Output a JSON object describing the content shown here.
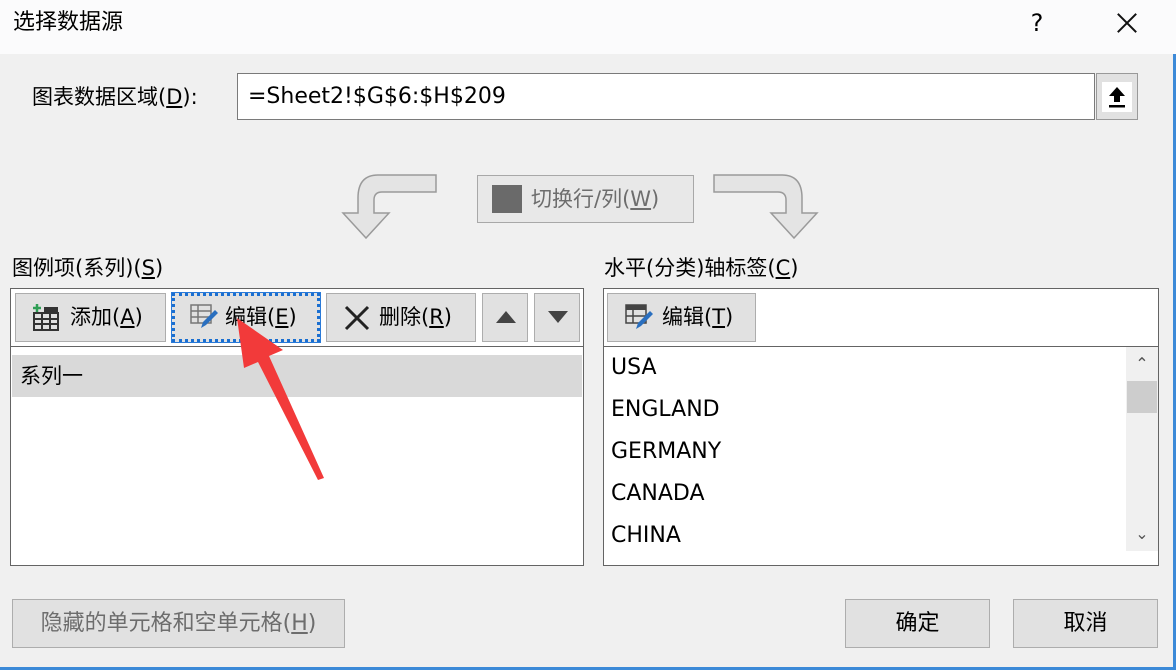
{
  "window": {
    "title": "选择数据源",
    "help_label": "?",
    "close_icon": "close-icon"
  },
  "range": {
    "label_prefix": "图表数据区域(",
    "label_key": "D",
    "label_suffix": "):",
    "value": "=Sheet2!$G$6:$H$209",
    "collapse_icon": "upload-arrow-icon"
  },
  "switch": {
    "label_prefix": "切换行/列(",
    "label_key": "W",
    "label_suffix": ")",
    "enabled": false
  },
  "series_panel": {
    "label_prefix": "图例项(系列)(",
    "label_key": "S",
    "label_suffix": ")",
    "toolbar": {
      "add": {
        "text": "添加(",
        "key": "A",
        "end": ")"
      },
      "edit": {
        "text": "编辑(",
        "key": "E",
        "end": ")"
      },
      "delete": {
        "text": "删除(",
        "key": "R",
        "end": ")"
      },
      "move_up_icon": "triangle-up-icon",
      "move_down_icon": "triangle-down-icon"
    },
    "items": [
      "系列一"
    ],
    "selected_index": 0
  },
  "axis_panel": {
    "label_prefix": "水平(分类)轴标签(",
    "label_key": "C",
    "label_suffix": ")",
    "edit": {
      "text": "编辑(",
      "key": "T",
      "end": ")"
    },
    "items": [
      "USA",
      "ENGLAND",
      "GERMANY",
      "CANADA",
      "CHINA"
    ]
  },
  "footer": {
    "hidden_cells": {
      "text": "隐藏的单元格和空单元格(",
      "key": "H",
      "end": ")"
    },
    "ok": "确定",
    "cancel": "取消"
  },
  "annotation": {
    "color": "#f23a3a",
    "points_to": "edit-series-button"
  }
}
